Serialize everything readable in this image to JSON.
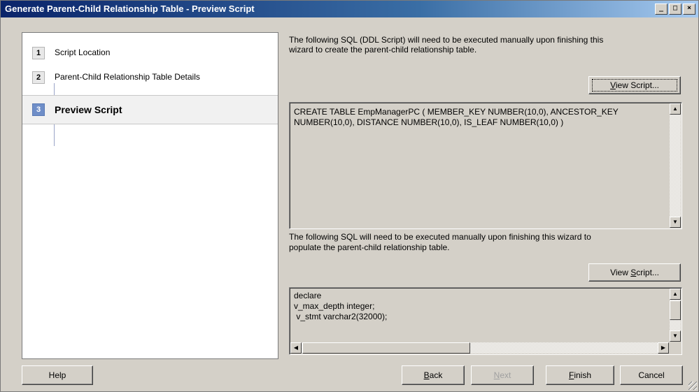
{
  "window": {
    "title": "Generate Parent-Child Relationship Table - Preview Script",
    "controls": {
      "minimize": "_",
      "maximize": "□",
      "close": "×"
    }
  },
  "steps": [
    {
      "number": "1",
      "label": "Script Location"
    },
    {
      "number": "2",
      "label": "Parent-Child Relationship Table Details"
    },
    {
      "number": "3",
      "label": "Preview Script",
      "active": true
    }
  ],
  "ddl_section": {
    "description_line1": "The following SQL (DDL Script) will need to be executed manually upon finishing this",
    "description_line2": "wizard to create the parent-child relationship table.",
    "view_button_pre": "",
    "view_button_key": "V",
    "view_button_post": "iew Script...",
    "script": "CREATE TABLE EmpManagerPC ( MEMBER_KEY NUMBER(10,0), ANCESTOR_KEY\nNUMBER(10,0), DISTANCE NUMBER(10,0), IS_LEAF NUMBER(10,0) )"
  },
  "populate_section": {
    "description_line1": "The following SQL will need to be executed manually upon finishing this wizard to",
    "description_line2": "populate the parent-child relationship table.",
    "view_button_pre": "View ",
    "view_button_key": "S",
    "view_button_post": "cript...",
    "script": "declare\nv_max_depth integer;\n v_stmt varchar2(32000);"
  },
  "footer": {
    "help": "Help",
    "back_key": "B",
    "back_rest": "ack",
    "next_key": "N",
    "next_rest": "ext",
    "finish_key": "F",
    "finish_rest": "inish",
    "cancel": "Cancel"
  },
  "colors": {
    "titlebar_start": "#0a246a",
    "titlebar_end": "#a6caf0",
    "active_step": "#6f8ec8",
    "dialog_face": "#d4d0c8"
  }
}
